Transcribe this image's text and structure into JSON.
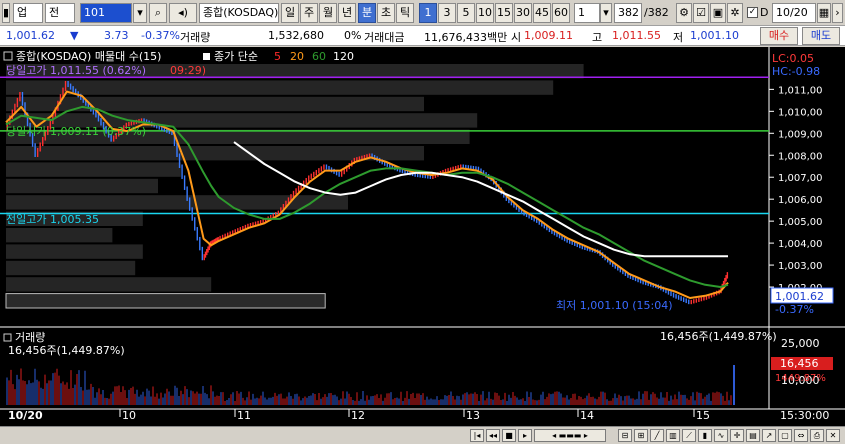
{
  "toolbar": {
    "mode": "업",
    "period": "전",
    "code": "101",
    "index_name": "종합(KOSDAQ)",
    "tabs": [
      "일",
      "주",
      "월",
      "년",
      "분",
      "초",
      "틱"
    ],
    "active_tab": "분",
    "intervals": [
      "1",
      "3",
      "5",
      "10",
      "15",
      "30",
      "45",
      "60"
    ],
    "active_interval": "1",
    "interval_select": "1",
    "count": "382",
    "count_total": "/382",
    "checkbox_label": "D",
    "date": "10/20"
  },
  "quote": {
    "price": "1,001.62",
    "arrow": "▼",
    "change": "3.73",
    "change_pct": "-0.37%",
    "volume_label": "거래량",
    "volume": "1,532,680",
    "vol_pct": "0%",
    "amount_label": "거래대금",
    "amount": "11,676,433백만",
    "open_label": "시",
    "open": "1,009.11",
    "high_label": "고",
    "high": "1,011.55",
    "low_label": "저",
    "low": "1,001.10",
    "buy": "매수",
    "sell": "매도"
  },
  "chart_panel": {
    "legend_name": "종합(KOSDAQ) 매물대 수(15)",
    "legend_ma": "종가 단순",
    "ma_periods": [
      "5",
      "20",
      "60",
      "120"
    ],
    "lc_label": "LC:0.05",
    "hc_label": "HC:-0.98",
    "today_high": "당일고가 1,011.55 (0.62%)",
    "today_high_tail": "09:29)",
    "today_open": "당일시가 1,009.11 (0.37%)",
    "prev_high": "전일고가 1,005.35",
    "low_marker": "최저 1,001.10 (15:04)",
    "last_price": "1,001.62",
    "last_pct": "-0.37%",
    "volume_title": "거래량",
    "volume_value": "16,456주(1,449.87%)",
    "volume_value_right": "16,456주(1,449.87%)",
    "vol_last_label": "16,456",
    "vol_last_pct": "1449.87%",
    "vol_axis_top": "25,000",
    "vol_axis_mid": "10,000",
    "time_labels": [
      "10/20",
      "10",
      "11",
      "12",
      "13",
      "14",
      "15",
      "15:30:00"
    ]
  },
  "chart_data": {
    "type": "line",
    "title": "종합(KOSDAQ)",
    "ylabel": "",
    "ylim": [
      1001.0,
      1012.2
    ],
    "yticks": [
      1011,
      1010,
      1009,
      1008,
      1007,
      1006,
      1005,
      1004,
      1003,
      1002
    ],
    "ytick_labels": [
      "1,011,00",
      "1,010,00",
      "1,009,00",
      "1,008,00",
      "1,007,00",
      "1,006,00",
      "1,005,00",
      "1,004,00",
      "1,003,00",
      "1,002,00"
    ],
    "x_hours": [
      "10",
      "11",
      "12",
      "13",
      "14",
      "15"
    ],
    "reference_lines": [
      {
        "name": "당일고가",
        "value": 1011.55,
        "color": "#a020f0"
      },
      {
        "name": "당일시가",
        "value": 1009.11,
        "color": "#3ad13a"
      },
      {
        "name": "전일고가",
        "value": 1005.35,
        "color": "#19d6f0"
      }
    ],
    "price_series": {
      "x_pct": [
        0,
        2,
        4,
        6,
        8,
        10,
        12,
        14,
        16,
        18,
        20,
        22,
        24,
        26,
        27,
        28,
        30,
        32,
        34,
        36,
        38,
        40,
        42,
        44,
        46,
        48,
        50,
        52,
        54,
        56,
        58,
        60,
        62,
        64,
        66,
        68,
        70,
        72,
        74,
        76,
        78,
        80,
        82,
        84,
        86,
        88,
        90,
        92,
        94,
        95
      ],
      "values": [
        1009.2,
        1010.8,
        1008.0,
        1009.5,
        1011.3,
        1010.6,
        1009.8,
        1008.7,
        1009.4,
        1009.6,
        1009.3,
        1009.0,
        1006.0,
        1003.3,
        1004.0,
        1004.2,
        1004.5,
        1004.8,
        1005.0,
        1005.4,
        1006.3,
        1007.0,
        1007.5,
        1007.1,
        1007.8,
        1008.0,
        1007.6,
        1007.3,
        1007.1,
        1007.0,
        1007.3,
        1007.5,
        1007.4,
        1006.9,
        1006.0,
        1005.4,
        1005.0,
        1004.5,
        1004.1,
        1003.8,
        1003.6,
        1003.0,
        1002.5,
        1002.2,
        1002.0,
        1001.6,
        1001.3,
        1001.5,
        1001.8,
        1002.6
      ]
    },
    "series": [
      {
        "name": "5",
        "color": "#ff9a1a",
        "values": [
          1009.5,
          1010.2,
          1009.3,
          1009.8,
          1010.9,
          1010.7,
          1010.0,
          1009.2,
          1009.1,
          1009.4,
          1009.4,
          1009.1,
          1007.3,
          1004.2,
          1003.9,
          1004.1,
          1004.4,
          1004.7,
          1004.9,
          1005.3,
          1006.1,
          1006.8,
          1007.3,
          1007.3,
          1007.7,
          1007.9,
          1007.7,
          1007.4,
          1007.2,
          1007.1,
          1007.2,
          1007.4,
          1007.3,
          1006.9,
          1006.1,
          1005.5,
          1005.1,
          1004.6,
          1004.2,
          1003.9,
          1003.6,
          1003.1,
          1002.6,
          1002.3,
          1002.0,
          1001.8,
          1001.5,
          1001.6,
          1001.8,
          1002.2
        ]
      },
      {
        "name": "20",
        "color": "#2e9b2e",
        "values": [
          1009.4,
          1009.8,
          1009.7,
          1009.6,
          1010.0,
          1010.2,
          1010.1,
          1009.8,
          1009.6,
          1009.5,
          1009.4,
          1009.3,
          1008.5,
          1007.2,
          1006.6,
          1006.1,
          1005.6,
          1005.3,
          1005.1,
          1005.1,
          1005.4,
          1005.8,
          1006.3,
          1006.7,
          1007.0,
          1007.3,
          1007.4,
          1007.4,
          1007.3,
          1007.2,
          1007.1,
          1007.2,
          1007.2,
          1007.0,
          1006.7,
          1006.3,
          1005.9,
          1005.5,
          1005.1,
          1004.7,
          1004.4,
          1004.0,
          1003.6,
          1003.2,
          1002.9,
          1002.6,
          1002.3,
          1002.1,
          1002.0,
          1002.1
        ]
      },
      {
        "name": "120",
        "color": "#ffffff",
        "values": [
          null,
          null,
          null,
          null,
          null,
          null,
          null,
          null,
          null,
          null,
          null,
          null,
          null,
          null,
          null,
          null,
          1008.6,
          1008.1,
          1007.6,
          1007.2,
          1006.8,
          1006.5,
          1006.3,
          1006.2,
          1006.3,
          1006.6,
          1006.9,
          1007.1,
          1007.2,
          1007.2,
          1007.1,
          1007.0,
          1006.8,
          1006.5,
          1006.2,
          1005.9,
          1005.5,
          1005.1,
          1004.7,
          1004.3,
          1004.0,
          1003.7,
          1003.5,
          1003.4,
          1003.4,
          1003.4,
          1003.4,
          1003.4,
          1003.4,
          1003.4
        ]
      }
    ],
    "volume_profile": {
      "rows": 15,
      "widths_pct": [
        76,
        72,
        55,
        62,
        61,
        55,
        23,
        20,
        45,
        18,
        14,
        18,
        17,
        27,
        42
      ]
    },
    "volume_bars": {
      "last_value": 16456,
      "ylim": [
        0,
        25000
      ]
    }
  }
}
